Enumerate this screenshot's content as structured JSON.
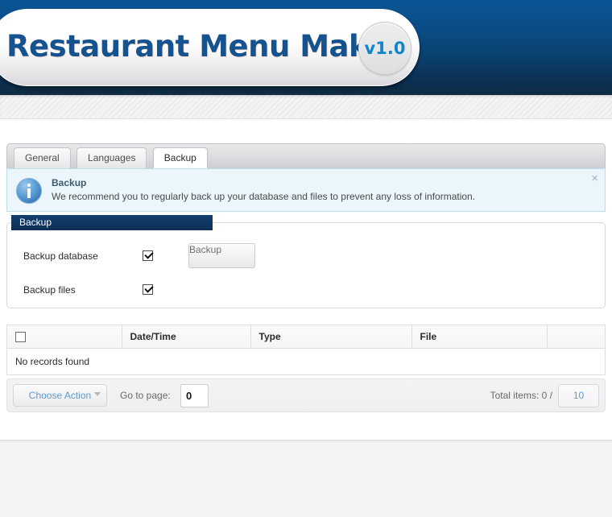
{
  "header": {
    "app_title": "Restaurant Menu Maker",
    "version_badge": "v1.0",
    "brand_color": "#14538f",
    "version_color": "#1285c8"
  },
  "tabs": [
    {
      "label": "General",
      "active": false
    },
    {
      "label": "Languages",
      "active": false
    },
    {
      "label": "Backup",
      "active": true
    }
  ],
  "notice": {
    "icon": "info-icon",
    "title": "Backup",
    "text": "We recommend you to regularly back up your database and files to prevent any loss of information.",
    "close_label": "×",
    "background": "#eaf6fc",
    "border": "#b9e0f0"
  },
  "fieldset": {
    "legend": "Backup",
    "legend_color": "#123e6e",
    "rows": [
      {
        "label": "Backup database",
        "checked": true
      },
      {
        "label": "Backup files",
        "checked": true
      }
    ],
    "action_button": "Backup"
  },
  "grid": {
    "columns": [
      {
        "label": "",
        "type": "checkbox"
      },
      {
        "label": "Date/Time"
      },
      {
        "label": "Type"
      },
      {
        "label": "File"
      },
      {
        "label": ""
      }
    ],
    "empty_message": "No records found",
    "rows": []
  },
  "footer": {
    "choose_action_label": "Choose Action",
    "goto_page_label": "Go to page:",
    "goto_page_value": "0",
    "total_items_label": "Total items: 0 /",
    "per_page_value": "10"
  }
}
